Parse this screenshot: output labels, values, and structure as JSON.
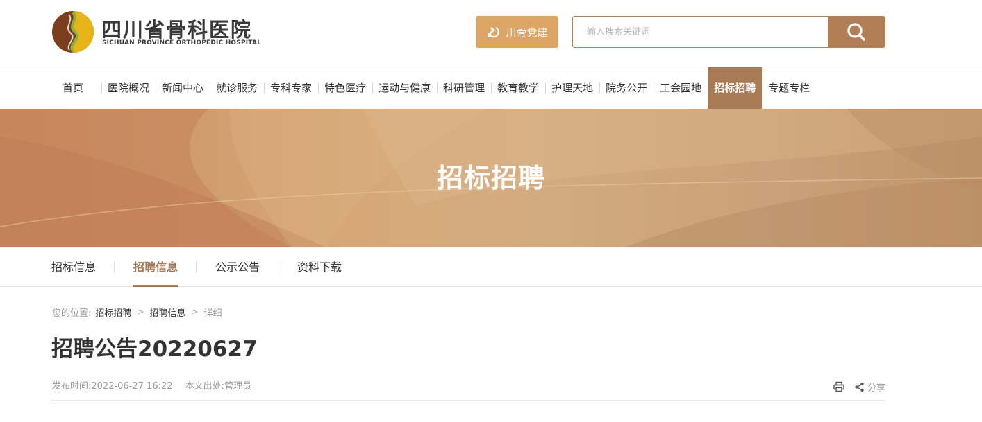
{
  "header": {
    "logo_cn": "四川省骨科医院",
    "logo_en": "SICHUAN PROVINCE ORTHOPEDIC HOSPITAL",
    "party_button": "川骨党建",
    "search_placeholder": "输入搜索关键词",
    "search_icon": "search-icon"
  },
  "nav": {
    "items": [
      {
        "label": "首页"
      },
      {
        "label": "医院概况"
      },
      {
        "label": "新闻中心"
      },
      {
        "label": "就诊服务"
      },
      {
        "label": "专科专家"
      },
      {
        "label": "特色医疗"
      },
      {
        "label": "运动与健康"
      },
      {
        "label": "科研管理"
      },
      {
        "label": "教育教学"
      },
      {
        "label": "护理天地"
      },
      {
        "label": "院务公开"
      },
      {
        "label": "工会园地"
      },
      {
        "label": "招标招聘"
      },
      {
        "label": "专题专栏"
      }
    ],
    "active_index": 12
  },
  "banner": {
    "title": "招标招聘"
  },
  "subnav": {
    "items": [
      {
        "label": "招标信息"
      },
      {
        "label": "招聘信息"
      },
      {
        "label": "公示公告"
      },
      {
        "label": "资料下载"
      }
    ],
    "active_index": 1
  },
  "breadcrumb": {
    "prefix": "您的位置:",
    "items": [
      "招标招聘",
      "招聘信息",
      "详细"
    ]
  },
  "article": {
    "title": "招聘公告20220627",
    "publish_time": "发布时间:2022-06-27 16:22",
    "source": "本文出处:管理员"
  },
  "tools": {
    "share_label": "分享",
    "print_icon": "printer-icon",
    "share_icon": "share-icon"
  },
  "colors": {
    "accent": "#a87a55",
    "party_button": "#dca465",
    "search_button": "#b27e56"
  }
}
